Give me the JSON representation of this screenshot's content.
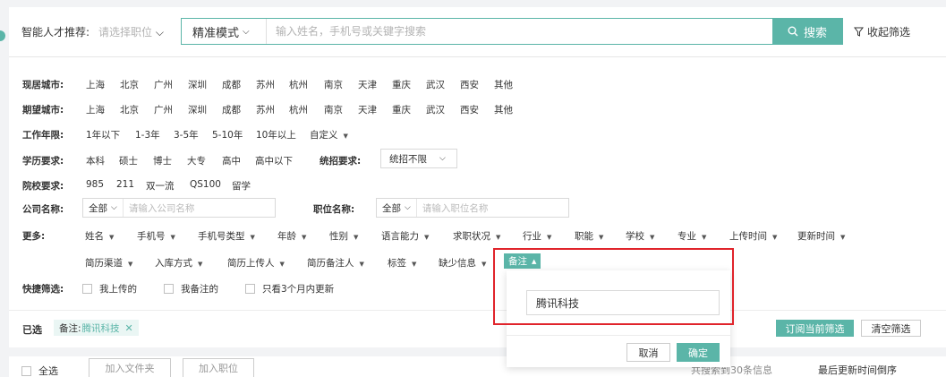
{
  "topbar": {
    "recommend_label": "智能人才推荐:",
    "position_select": "请选择职位",
    "mode": "精准模式",
    "search_placeholder": "输入姓名，手机号或关键字搜索",
    "search_button": "搜索",
    "collapse": "收起筛选"
  },
  "filters": {
    "current_city": {
      "label": "现居城市:",
      "options": [
        "上海",
        "北京",
        "广州",
        "深圳",
        "成都",
        "苏州",
        "杭州",
        "南京",
        "天津",
        "重庆",
        "武汉",
        "西安",
        "其他"
      ]
    },
    "expected_city": {
      "label": "期望城市:",
      "options": [
        "上海",
        "北京",
        "广州",
        "深圳",
        "成都",
        "苏州",
        "杭州",
        "南京",
        "天津",
        "重庆",
        "武汉",
        "西安",
        "其他"
      ]
    },
    "work_years": {
      "label": "工作年限:",
      "options": [
        "1年以下",
        "1-3年",
        "3-5年",
        "5-10年",
        "10年以上",
        "自定义"
      ]
    },
    "education": {
      "label": "学历要求:",
      "options": [
        "本科",
        "硕士",
        "博士",
        "大专",
        "高中",
        "高中以下"
      ]
    },
    "unified": {
      "label": "统招要求:",
      "value": "统招不限"
    },
    "school": {
      "label": "院校要求:",
      "options": [
        "985",
        "211",
        "双一流",
        "QS100",
        "留学"
      ]
    },
    "company": {
      "label": "公司名称:",
      "scope": "全部",
      "placeholder": "请输入公司名称"
    },
    "position": {
      "label": "职位名称:",
      "scope": "全部",
      "placeholder": "请输入职位名称"
    },
    "more": {
      "label": "更多:",
      "row1": [
        "姓名",
        "手机号",
        "手机号类型",
        "年龄",
        "性别",
        "语言能力",
        "求职状况",
        "行业",
        "职能",
        "学校",
        "专业",
        "上传时间",
        "更新时间"
      ],
      "row2": [
        "简历渠道",
        "入库方式",
        "简历上传人",
        "简历备注人",
        "标签",
        "缺少信息"
      ],
      "active": "备注"
    },
    "quick": {
      "label": "快捷筛选:",
      "options": [
        "我上传的",
        "我备注的",
        "只看3个月内更新"
      ]
    }
  },
  "selected": {
    "label": "已选",
    "tag_key": "备注:",
    "tag_value": "腾讯科技",
    "subscribe": "订阅当前筛选",
    "clear": "清空筛选"
  },
  "popup": {
    "value": "腾讯科技",
    "cancel": "取消",
    "confirm": "确定"
  },
  "bottom": {
    "select_all": "全选",
    "add_folder": "加入文件夹",
    "add_position": "加入职位",
    "result": "共搜索到30条信息",
    "sort": "最后更新时间倒序"
  }
}
